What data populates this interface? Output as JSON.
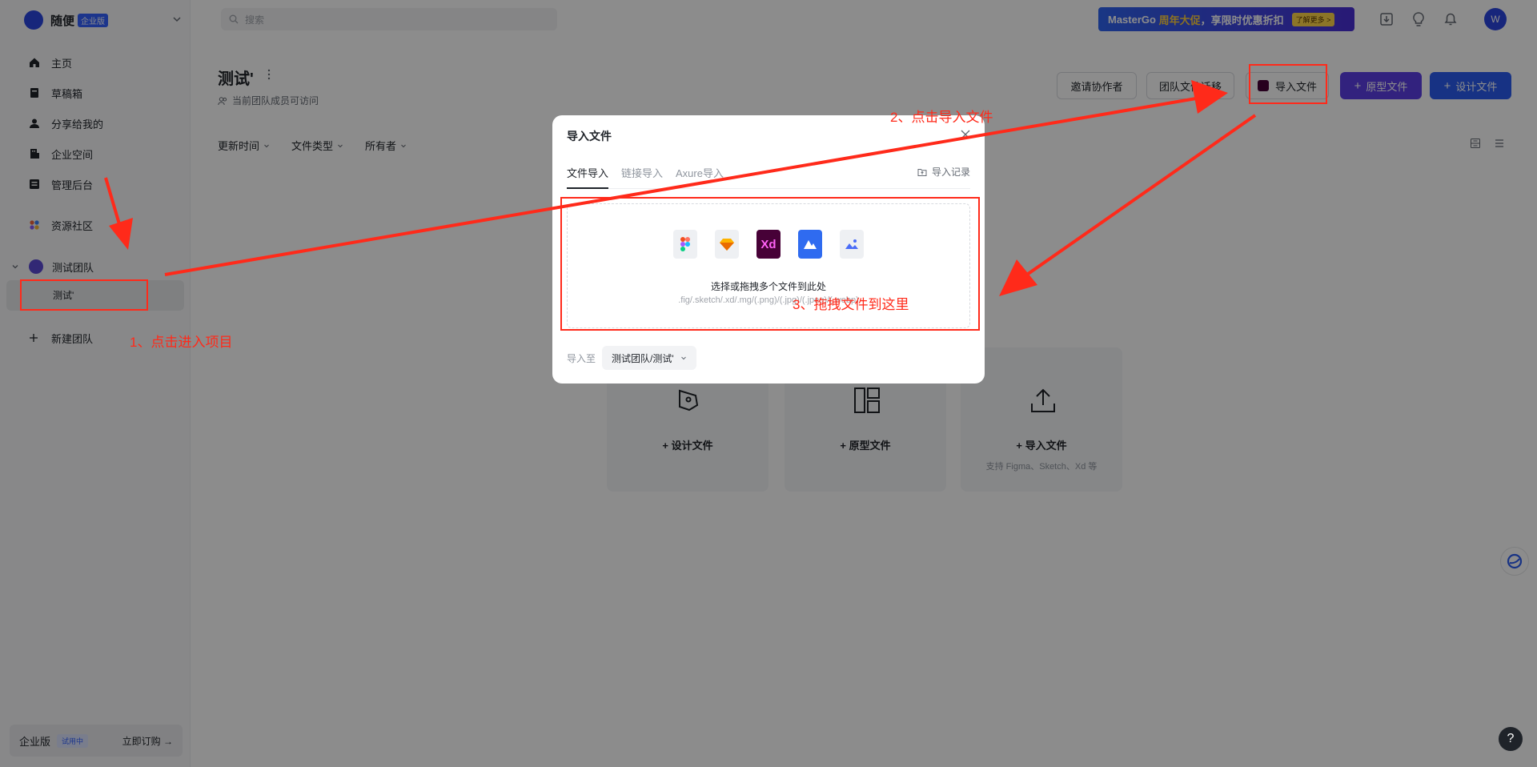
{
  "workspace": {
    "name": "随便",
    "badge": "企业版"
  },
  "sidebar": {
    "items": [
      {
        "label": "主页"
      },
      {
        "label": "草稿箱"
      },
      {
        "label": "分享给我的"
      },
      {
        "label": "企业空间"
      },
      {
        "label": "管理后台"
      },
      {
        "label": "资源社区"
      }
    ],
    "team": {
      "name": "测试团队"
    },
    "project": {
      "name": "测试'"
    },
    "new_team": "新建团队",
    "enterprise": {
      "label": "企业版",
      "badge": "试用中",
      "buy": "立即订购 →"
    }
  },
  "topbar": {
    "search_placeholder": "搜索",
    "promo": {
      "brand": "MasterGo",
      "highlight": "周年大促",
      "text": "，享限时优惠折扣",
      "pill": "了解更多 >"
    },
    "avatar": "W"
  },
  "project": {
    "title": "测试'",
    "access": "当前团队成员可访问"
  },
  "actions": {
    "invite": "邀请协作者",
    "migrate": "团队文件迁移",
    "import": "导入文件",
    "prototype": "原型文件",
    "design": "设计文件"
  },
  "filters": [
    "更新时间",
    "文件类型",
    "所有者"
  ],
  "cards": [
    {
      "label": "设计文件",
      "sub": ""
    },
    {
      "label": "原型文件",
      "sub": ""
    },
    {
      "label": "导入文件",
      "sub": "支持 Figma、Sketch、Xd 等"
    }
  ],
  "modal": {
    "title": "导入文件",
    "tabs": [
      "文件导入",
      "链接导入",
      "Axure导入"
    ],
    "import_log": "导入记录",
    "file_icons": [
      "figma-icon",
      "sketch-icon",
      "xd-icon",
      "mastergo-icon",
      "image-icon"
    ],
    "xd_label": "Xd",
    "dropzone_title": "选择或拖拽多个文件到此处",
    "dropzone_ext": ".fig/.sketch/.xd/.mg/(.png)/(.jpg)/(.jpeg)/(.webp)",
    "import_to_label": "导入至",
    "destination": "测试团队/测试'"
  },
  "annotations": {
    "step1": "1、点击进入项目",
    "step2": "2、点击导入文件",
    "step3": "3、拖拽文件到这里",
    "color": "#ff2a1a"
  },
  "help": "?"
}
